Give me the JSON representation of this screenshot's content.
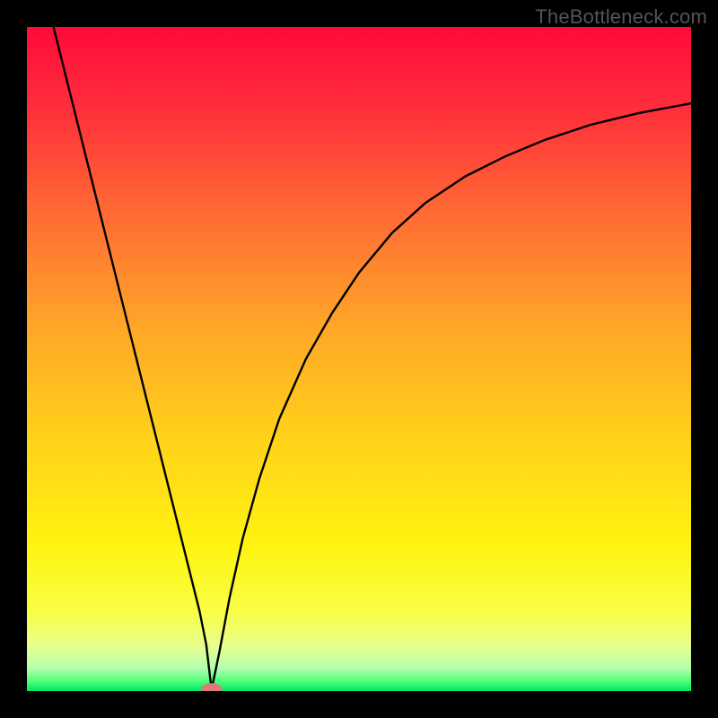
{
  "watermark": "TheBottleneck.com",
  "chart_data": {
    "type": "line",
    "title": "",
    "xlabel": "",
    "ylabel": "",
    "xlim": [
      0,
      100
    ],
    "ylim": [
      0,
      100
    ],
    "grid": false,
    "gradient_stops": [
      {
        "pos": 0.0,
        "color": "#ff0a3a"
      },
      {
        "pos": 0.12,
        "color": "#ff2d3b"
      },
      {
        "pos": 0.28,
        "color": "#ff6a34"
      },
      {
        "pos": 0.45,
        "color": "#ffa628"
      },
      {
        "pos": 0.62,
        "color": "#ffd21a"
      },
      {
        "pos": 0.78,
        "color": "#fff310"
      },
      {
        "pos": 0.88,
        "color": "#f8ff44"
      },
      {
        "pos": 0.93,
        "color": "#e9ff8a"
      },
      {
        "pos": 0.965,
        "color": "#b6ffb0"
      },
      {
        "pos": 0.985,
        "color": "#4eff7a"
      },
      {
        "pos": 1.0,
        "color": "#00e565"
      }
    ],
    "series": [
      {
        "name": "left-branch",
        "stroke": "#000000",
        "x": [
          4.0,
          6.0,
          8.0,
          10.0,
          12.0,
          14.0,
          16.0,
          18.0,
          20.0,
          22.0,
          24.0,
          26.0,
          27.0,
          27.8
        ],
        "y": [
          100.0,
          92.0,
          84.0,
          76.0,
          68.0,
          60.0,
          52.0,
          44.0,
          36.0,
          28.0,
          20.0,
          12.0,
          7.0,
          0.2
        ]
      },
      {
        "name": "right-branch",
        "stroke": "#000000",
        "x": [
          27.8,
          29.0,
          30.5,
          32.5,
          35.0,
          38.0,
          42.0,
          46.0,
          50.0,
          55.0,
          60.0,
          66.0,
          72.0,
          78.0,
          85.0,
          92.0,
          100.0
        ],
        "y": [
          0.2,
          6.0,
          14.0,
          23.0,
          32.0,
          41.0,
          50.0,
          57.0,
          63.0,
          69.0,
          73.5,
          77.5,
          80.5,
          83.0,
          85.3,
          87.0,
          88.5
        ]
      }
    ],
    "marker": {
      "name": "min-point",
      "x": 27.8,
      "y": 0.2,
      "color": "#e07a7a",
      "rx": 1.6,
      "ry": 1.0
    }
  }
}
